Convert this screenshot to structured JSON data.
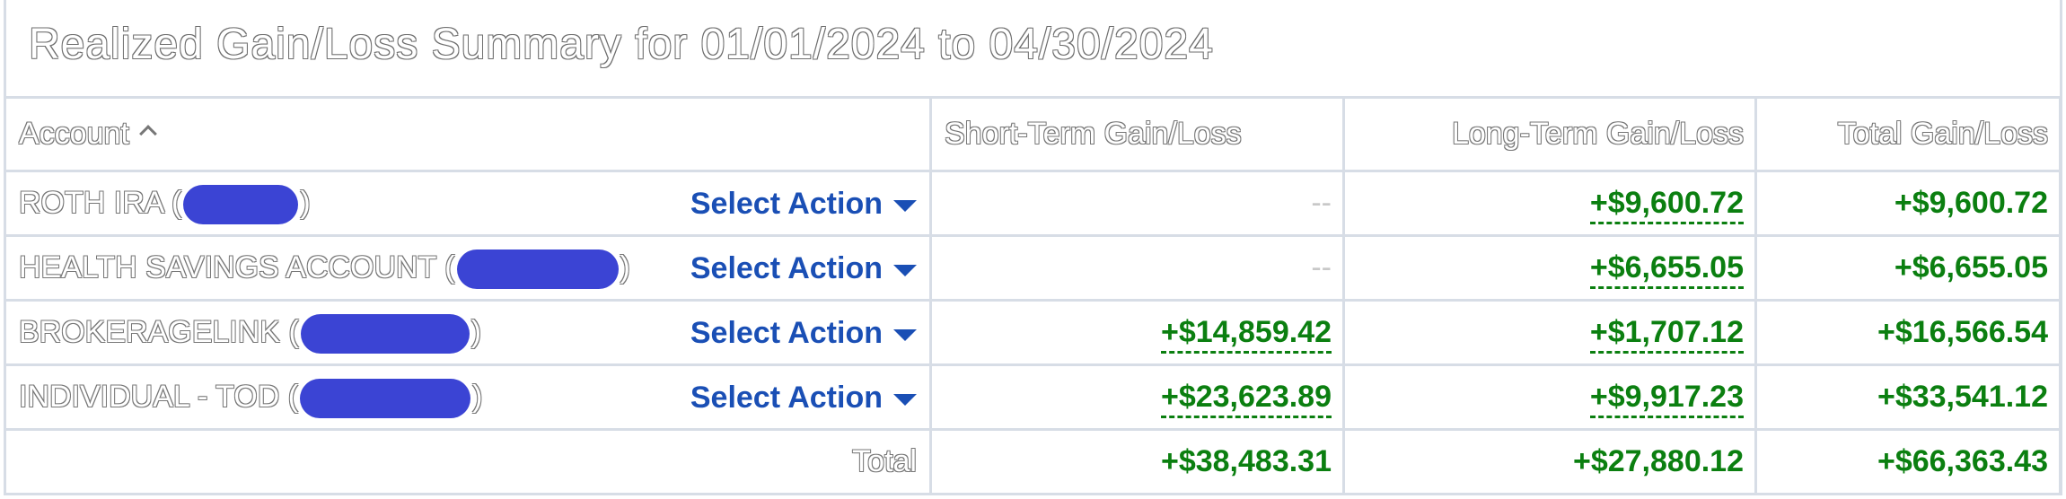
{
  "title": "Realized Gain/Loss Summary for 01/01/2024 to 04/30/2024",
  "columns": {
    "account": "Account",
    "short_term": "Short-Term Gain/Loss",
    "long_term": "Long-Term Gain/Loss",
    "total": "Total Gain/Loss"
  },
  "action_label": "Select Action",
  "rows": [
    {
      "name": "ROTH IRA",
      "short_term": "--",
      "long_term": "+$9,600.72",
      "total": "+$9,600.72"
    },
    {
      "name": "HEALTH SAVINGS ACCOUNT",
      "short_term": "--",
      "long_term": "+$6,655.05",
      "total": "+$6,655.05"
    },
    {
      "name": "BROKERAGELINK",
      "short_term": "+$14,859.42",
      "long_term": "+$1,707.12",
      "total": "+$16,566.54"
    },
    {
      "name": "INDIVIDUAL - TOD",
      "short_term": "+$23,623.89",
      "long_term": "+$9,917.23",
      "total": "+$33,541.12"
    }
  ],
  "totals": {
    "label": "Total",
    "short_term": "+$38,483.31",
    "long_term": "+$27,880.12",
    "total": "+$66,363.43"
  },
  "colors": {
    "gain": "#0b7f10",
    "action": "#1a4fb5",
    "redaction": "#3b44d4",
    "border": "#d7dde6"
  }
}
